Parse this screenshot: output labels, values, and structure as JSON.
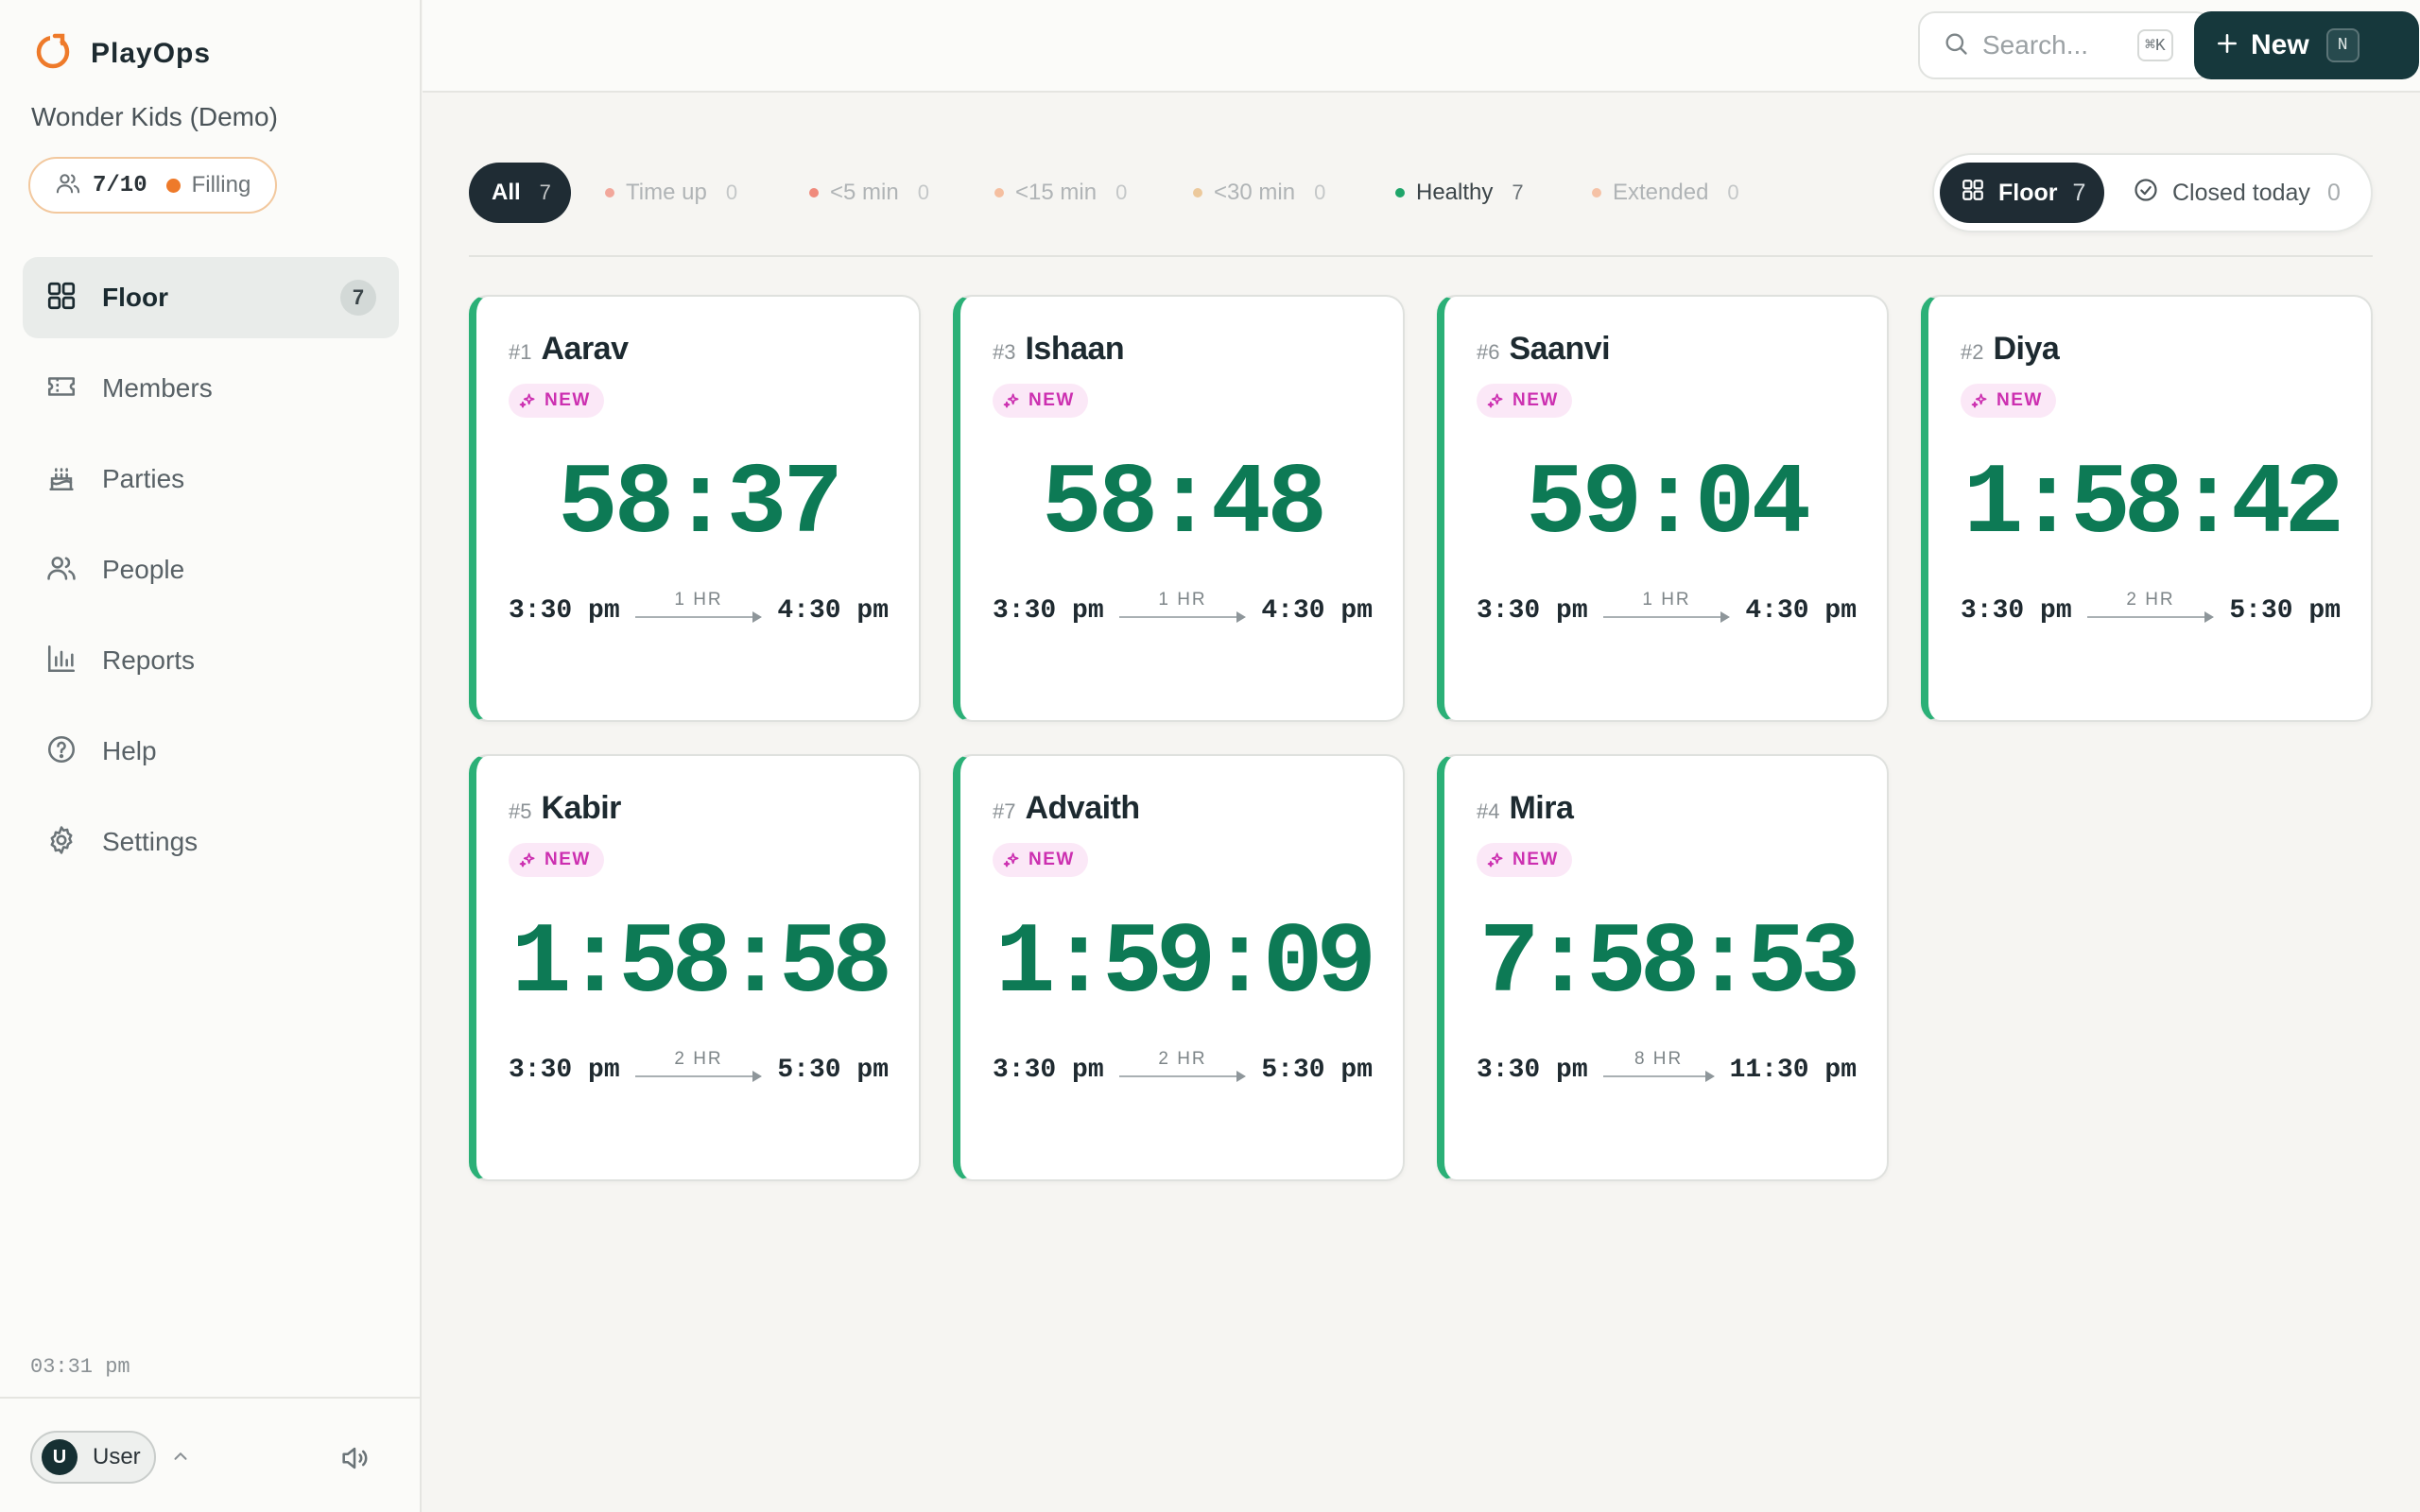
{
  "brand": {
    "name": "PlayOps",
    "org": "Wonder Kids (Demo)"
  },
  "capacity": {
    "count": "7/10",
    "status": "Filling",
    "status_color": "#ee7a2a"
  },
  "nav": [
    {
      "label": "Floor",
      "icon": "grid-icon",
      "badge": "7",
      "active": true
    },
    {
      "label": "Members",
      "icon": "ticket-icon"
    },
    {
      "label": "Parties",
      "icon": "cake-icon"
    },
    {
      "label": "People",
      "icon": "users-icon"
    },
    {
      "label": "Reports",
      "icon": "bar-chart-icon"
    },
    {
      "label": "Help",
      "icon": "help-circle-icon"
    },
    {
      "label": "Settings",
      "icon": "gear-icon"
    }
  ],
  "clock": "03:31 pm",
  "user": {
    "initial": "U",
    "name": "User"
  },
  "topbar": {
    "search_placeholder": "Search...",
    "search_shortcut": "⌘K",
    "new_label": "New",
    "new_shortcut": "N"
  },
  "filters": {
    "all": {
      "label": "All",
      "count": "7"
    },
    "items": [
      {
        "label": "Time up",
        "count": "0",
        "color": "#f2a79b"
      },
      {
        "label": "<5 min",
        "count": "0",
        "color": "#f08a7c"
      },
      {
        "label": "<15 min",
        "count": "0",
        "color": "#f5bfa0"
      },
      {
        "label": "<30 min",
        "count": "0",
        "color": "#ecc99c"
      },
      {
        "label": "Healthy",
        "count": "7",
        "color": "#1fa56a"
      },
      {
        "label": "Extended",
        "count": "0",
        "color": "#f5c2a6"
      }
    ]
  },
  "view": {
    "floor": {
      "label": "Floor",
      "count": "7"
    },
    "closed": {
      "label": "Closed today",
      "count": "0"
    }
  },
  "accent": "#2bb077",
  "timer_color": "#0d7a55",
  "sessions": [
    {
      "num": "#1",
      "name": "Aarav",
      "badge": "NEW",
      "timer": "58:37",
      "start": "3:30 pm",
      "duration": "1 HR",
      "end": "4:30 pm"
    },
    {
      "num": "#3",
      "name": "Ishaan",
      "badge": "NEW",
      "timer": "58:48",
      "start": "3:30 pm",
      "duration": "1 HR",
      "end": "4:30 pm"
    },
    {
      "num": "#6",
      "name": "Saanvi",
      "badge": "NEW",
      "timer": "59:04",
      "start": "3:30 pm",
      "duration": "1 HR",
      "end": "4:30 pm"
    },
    {
      "num": "#2",
      "name": "Diya",
      "badge": "NEW",
      "timer": "1:58:42",
      "start": "3:30 pm",
      "duration": "2 HR",
      "end": "5:30 pm"
    },
    {
      "num": "#5",
      "name": "Kabir",
      "badge": "NEW",
      "timer": "1:58:58",
      "start": "3:30 pm",
      "duration": "2 HR",
      "end": "5:30 pm"
    },
    {
      "num": "#7",
      "name": "Advaith",
      "badge": "NEW",
      "timer": "1:59:09",
      "start": "3:30 pm",
      "duration": "2 HR",
      "end": "5:30 pm"
    },
    {
      "num": "#4",
      "name": "Mira",
      "badge": "NEW",
      "timer": "7:58:53",
      "start": "3:30 pm",
      "duration": "8 HR",
      "end": "11:30 pm"
    }
  ]
}
